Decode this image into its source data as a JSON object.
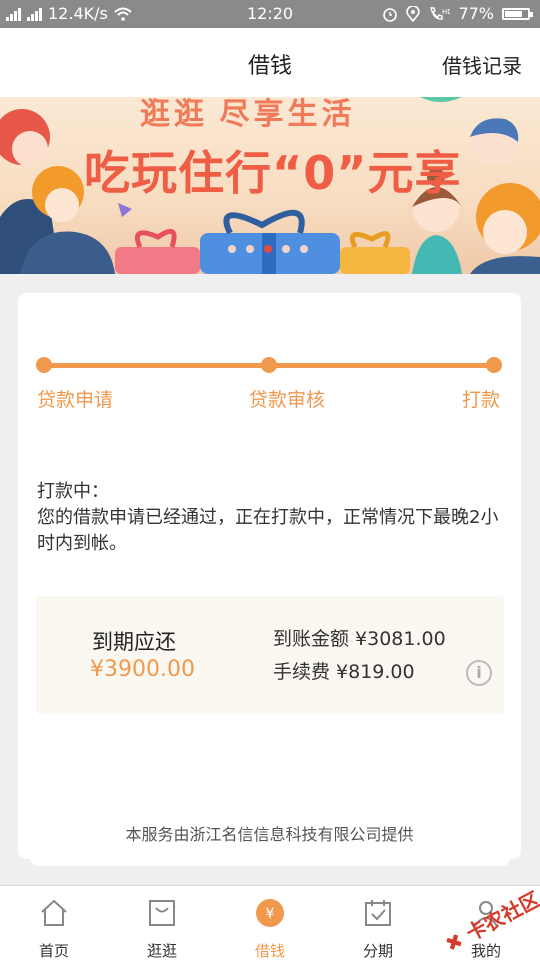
{
  "status_bar": {
    "network_speed": "12.4K/s",
    "time": "12:20",
    "battery": "77%",
    "battery_level": 0.77
  },
  "nav": {
    "title": "借钱",
    "record_label": "借钱记录"
  },
  "banner": {
    "subtitle": "逛逛 尽享生活",
    "headline": "吃玩住行“0”元享"
  },
  "progress": {
    "steps": [
      "贷款申请",
      "贷款审核",
      "打款"
    ]
  },
  "message": {
    "title": "打款中：",
    "body": "您的借款申请已经通过，正在打款中，正常情况下最晚2小时内到帐。"
  },
  "due": {
    "label": "到期应还",
    "amount": "¥3900.00",
    "arrive_text": "到账金额 ¥3081.00",
    "fee_text": "手续费 ¥819.00",
    "info_glyph": "i"
  },
  "provider": "本服务由浙江名信信息科技有限公司提供",
  "tabs": [
    {
      "label": "首页",
      "icon": "home-icon"
    },
    {
      "label": "逛逛",
      "icon": "shopping-bag-icon"
    },
    {
      "label": "借钱",
      "icon": "yen-coin-icon"
    },
    {
      "label": "分期",
      "icon": "calendar-check-icon"
    },
    {
      "label": "我的",
      "icon": "profile-icon"
    }
  ],
  "active_tab": 2,
  "watermark": "卡农社区",
  "colors": {
    "accent": "#f0994d",
    "banner_text": "#ef5d45",
    "status_bar": "#8a8a8a"
  }
}
